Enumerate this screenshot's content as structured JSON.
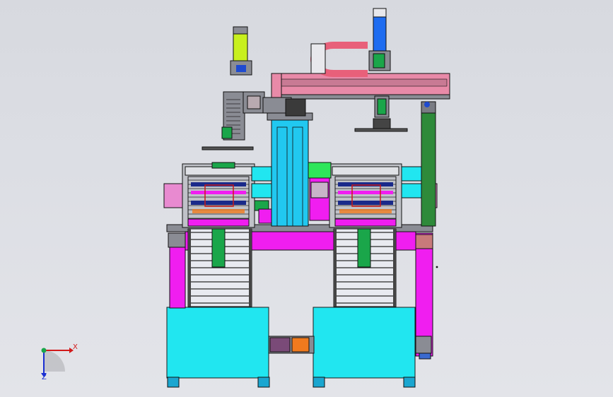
{
  "viewport": {
    "background": "#dcdee4",
    "colors": {
      "cyan": "#21e6f0",
      "magenta": "#f01ef0",
      "pink": "#e88aa8",
      "blue": "#1e6cf0",
      "green": "#1aa64a",
      "lime": "#c8f01e",
      "dark_green": "#2e8a3a",
      "orange": "#f07a1e",
      "gray": "#8a8c94",
      "navy": "#1a2a8a"
    }
  },
  "triad": {
    "x_label": "X",
    "z_label": "Z",
    "x_color": "#d21a1a",
    "y_color": "#1aa64a",
    "z_color": "#1a2fd2",
    "icon": "coordinate-triad-icon"
  }
}
